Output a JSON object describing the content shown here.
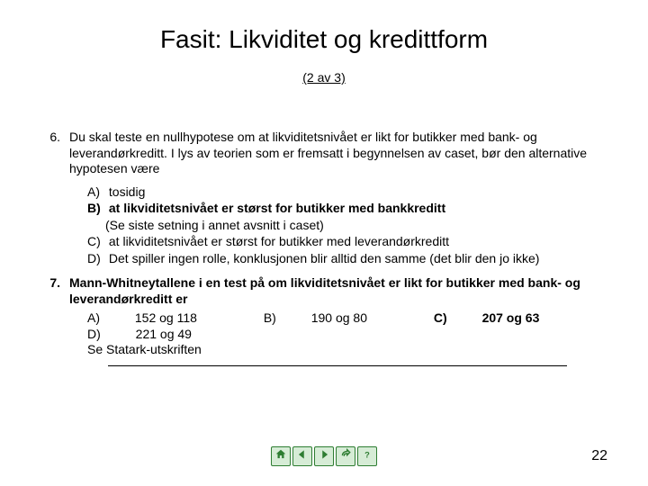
{
  "title": "Fasit: Likviditet og kredittform",
  "subtitle": "(2 av 3)",
  "q6": {
    "num": "6.",
    "text": "Du skal teste en nullhypotese om at likviditetsnivået er likt for butikker med bank- og leverandørkreditt. I lys av teorien som er fremsatt i begynnelsen av caset, bør den alternative hypotesen være",
    "options": [
      {
        "label": "A)",
        "text": "tosidig",
        "bold": false
      },
      {
        "label": "B)",
        "text": "at likviditetsnivået er størst for butikker med bankkreditt",
        "bold": true
      },
      {
        "label": "",
        "text": "(Se siste setning i annet avsnitt i caset)",
        "bold": false,
        "note": true
      },
      {
        "label": "C)",
        "text": "at likviditetsnivået er størst for butikker med leverandørkreditt",
        "bold": false
      },
      {
        "label": "D)",
        "text": "Det spiller ingen rolle, konklusjonen blir alltid den samme (det blir den jo ikke)",
        "bold": false
      }
    ]
  },
  "q7": {
    "num": "7.",
    "text": "Mann-Whitneytallene i en test på om likviditetsnivået er likt for butikker med bank- og leverandørkreditt er",
    "options": [
      {
        "label": "A)",
        "text": "152 og 118",
        "bold": false
      },
      {
        "label": "B)",
        "text": "190 og 80",
        "bold": false
      },
      {
        "label": "C)",
        "text": "207 og 63",
        "bold": true
      },
      {
        "label": "D)",
        "text": "221 og 49",
        "bold": false
      }
    ],
    "note": "Se Statark-utskriften"
  },
  "nav": {
    "home": "home-icon",
    "prev": "prev-icon",
    "next": "next-icon",
    "return": "return-icon",
    "help": "help-icon"
  },
  "pagenum": "22"
}
